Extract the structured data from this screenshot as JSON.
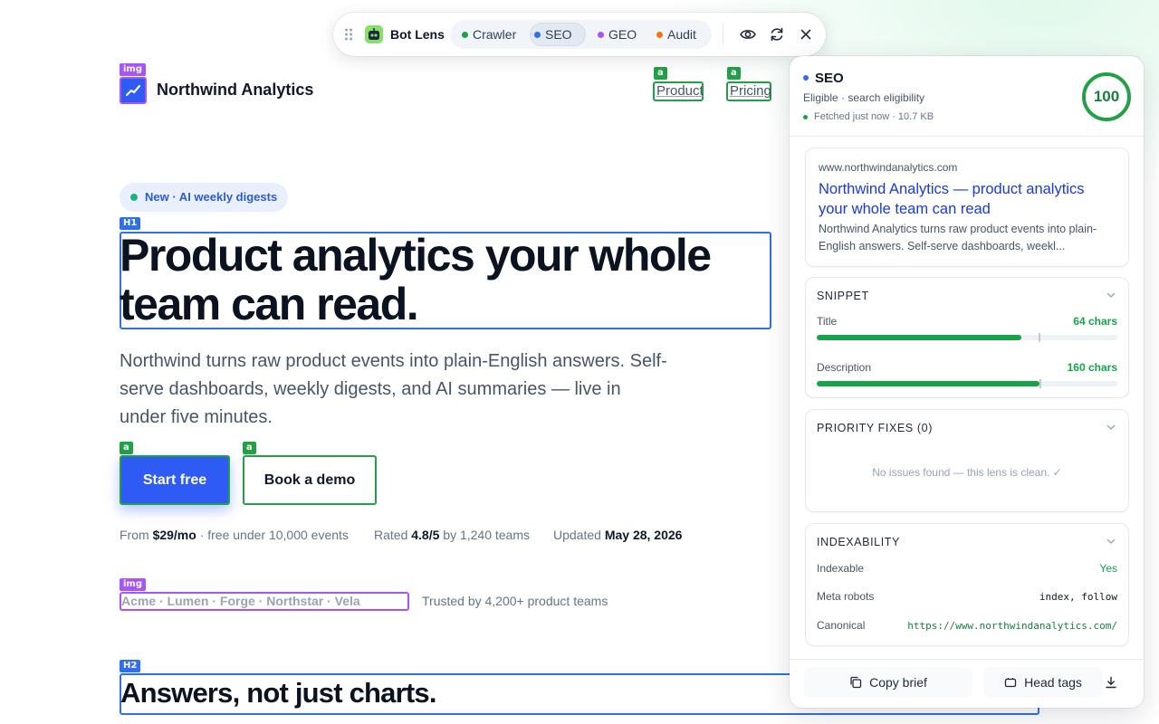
{
  "site": {
    "brand": "Northwind Analytics",
    "nav": [
      "Product",
      "Pricing"
    ],
    "pill": "New · AI weekly digests",
    "headline": "Product analytics your whole team can read.",
    "lede": "Northwind turns raw product events into plain-English answers. Self-serve dashboards, weekly digests, and AI summaries — live in under five minutes.",
    "cta_primary": "Start free",
    "cta_secondary": "Book a demo",
    "meta": {
      "price_prefix": "From",
      "price": "$29/mo",
      "price_suffix": "· free under 10,000 events",
      "rating_prefix": "Rated",
      "rating": "4.8/5",
      "rating_suffix": "by 1,240 teams",
      "updated_prefix": "Updated",
      "updated": "May 28, 2026"
    },
    "logos": "Acme · Lumen · Forge · Northstar · Vela",
    "trusted": "Trusted by 4,200+ product teams",
    "h2": "Answers, not just charts."
  },
  "annotations": {
    "img": "img",
    "a": "a",
    "h1": "H1",
    "h2": "H2"
  },
  "toolbar": {
    "name": "Bot Lens",
    "tabs": [
      {
        "label": "Crawler",
        "color": "#22a046"
      },
      {
        "label": "SEO",
        "color": "#2f6fed"
      },
      {
        "label": "GEO",
        "color": "#a855f7"
      },
      {
        "label": "Audit",
        "color": "#f97316"
      }
    ],
    "active_tab": "SEO",
    "icons": [
      "grip-icon",
      "eye-icon",
      "refresh-icon",
      "close-icon"
    ]
  },
  "panel": {
    "title": "SEO",
    "subtitle": "Eligible · search eligibility",
    "fetched": "Fetched just now · 10.7 KB",
    "score": "100",
    "serp": {
      "url": "www.northwindanalytics.com",
      "title": "Northwind Analytics — product analytics your whole team can read",
      "description": "Northwind Analytics turns raw product events into plain-English answers. Self-serve dashboards, weekl..."
    },
    "snippet": {
      "heading": "SNIPPET",
      "title_label": "Title",
      "title_value": "64 chars",
      "title_fill": 0.68,
      "description_label": "Description",
      "description_value": "160 chars",
      "description_fill": 0.74
    },
    "fixes": {
      "heading": "PRIORITY FIXES (0)",
      "empty": "No issues found — this lens is clean. ✓"
    },
    "indexability": {
      "heading": "INDEXABILITY",
      "rows": [
        {
          "label": "Indexable",
          "value": "Yes"
        },
        {
          "label": "Meta robots",
          "value": "index, follow"
        },
        {
          "label": "Canonical",
          "value": "https://www.northwindanalytics.com/"
        }
      ]
    },
    "footer": {
      "copy": "Copy brief",
      "head": "Head tags"
    },
    "colors": {
      "accent": "#2f6fed",
      "good": "#22a046",
      "link": "#1a3ad6"
    }
  }
}
